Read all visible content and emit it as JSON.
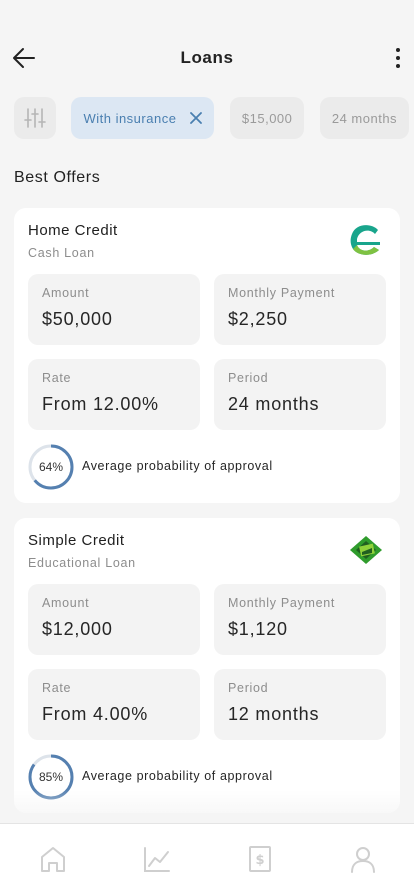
{
  "header": {
    "title": "Loans",
    "back_icon": "arrow-left-icon",
    "more_icon": "more-vertical-icon"
  },
  "filters": {
    "settings_icon": "sliders-icon",
    "chips": [
      {
        "label": "With insurance",
        "active": true
      },
      {
        "label": "$15,000",
        "active": false
      },
      {
        "label": "24 months",
        "active": false
      }
    ]
  },
  "section": {
    "title": "Best Offers"
  },
  "offers": [
    {
      "bank": "Home Credit",
      "loan_type": "Cash Loan",
      "logo_icon": "home-credit-logo-icon",
      "amount_label": "Amount",
      "amount": "$50,000",
      "payment_label": "Monthly Payment",
      "payment": "$2,250",
      "rate_label": "Rate",
      "rate": "From 12.00%",
      "period_label": "Period",
      "period": "24 months",
      "probability": 0.64,
      "probability_text": "64%",
      "probability_label": "Average probability of approval"
    },
    {
      "bank": "Simple Credit",
      "loan_type": "Educational Loan",
      "logo_icon": "simple-credit-logo-icon",
      "amount_label": "Amount",
      "amount": "$12,000",
      "payment_label": "Monthly Payment",
      "payment": "$1,120",
      "rate_label": "Rate",
      "rate": "From 4.00%",
      "period_label": "Period",
      "period": "12 months",
      "probability": 0.85,
      "probability_text": "85%",
      "probability_label": "Average probability of approval"
    }
  ],
  "tabbar": {
    "items": [
      "home-icon",
      "chart-icon",
      "bill-icon",
      "profile-icon"
    ]
  },
  "colors": {
    "accent": "#4a7fb0",
    "ring_track": "#dde3ea",
    "ring_fill": "#5580b0",
    "chip_active_bg": "#dce7f3"
  }
}
